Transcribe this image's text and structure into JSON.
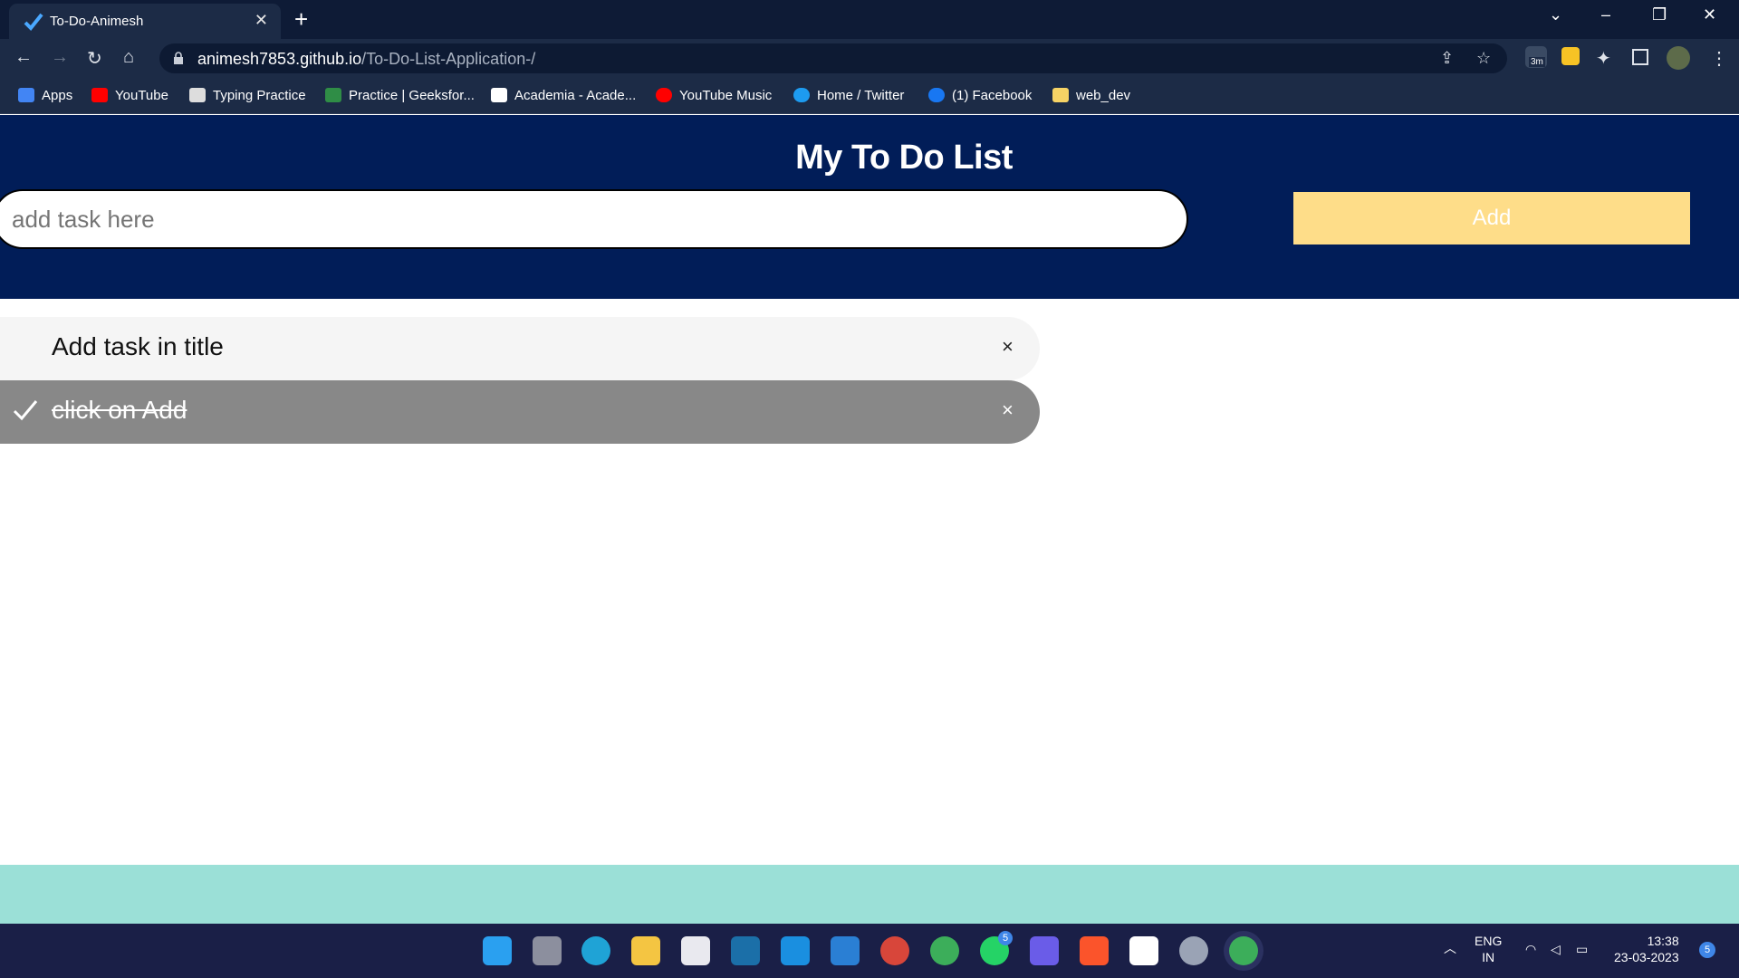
{
  "browser": {
    "tab_title": "To-Do-Animesh",
    "tab_close": "✕",
    "new_tab": "+",
    "url_domain": "animesh7853.github.io",
    "url_path": "/To-Do-List-Application-/",
    "extension_badge": "3m",
    "bookmarks": [
      {
        "label": "Apps",
        "icon": "apps-grid-icon",
        "color": "#4285f4"
      },
      {
        "label": "YouTube",
        "icon": "youtube-icon",
        "color": "#ff0000"
      },
      {
        "label": "Typing Practice",
        "icon": "typing-practice-icon",
        "color": "#dddddd"
      },
      {
        "label": "Practice | Geeksfor...",
        "icon": "geeksforgeeks-icon",
        "color": "#2f8d46"
      },
      {
        "label": "Academia - Acade...",
        "icon": "academia-icon",
        "color": "#ffffff"
      },
      {
        "label": "YouTube Music",
        "icon": "youtube-music-icon",
        "color": "#ff0000"
      },
      {
        "label": "Home / Twitter",
        "icon": "twitter-icon",
        "color": "#1d9bf0"
      },
      {
        "label": "(1) Facebook",
        "icon": "facebook-icon",
        "color": "#1877f2"
      },
      {
        "label": "web_dev",
        "icon": "folder-icon",
        "color": "#f6d365"
      }
    ]
  },
  "app": {
    "title": "My To Do List",
    "input_placeholder": "add task here",
    "add_label": "Add",
    "tasks": [
      {
        "label": "Add task in title",
        "done": false,
        "close": "×"
      },
      {
        "label": "click on Add",
        "done": true,
        "close": "×"
      }
    ]
  },
  "taskbar": {
    "apps": [
      "start-icon",
      "task-view-icon",
      "edge-icon",
      "file-explorer-icon",
      "store-icon",
      "prime-video-icon",
      "l-app-icon",
      "vscode-icon",
      "color-app-icon",
      "chrome-icon",
      "whatsapp-icon",
      "clipchamp-icon",
      "brave-icon",
      "notion-icon",
      "settings-icon",
      "chrome-profile-icon"
    ],
    "whatsapp_badge": "5",
    "language_line1": "ENG",
    "language_line2": "IN",
    "time": "13:38",
    "date": "23-03-2023",
    "notification_count": "5"
  },
  "colors": {
    "header_bg": "#011d58",
    "add_button": "#fedd89",
    "done_task": "#888888",
    "footer": "#9be0d7"
  }
}
